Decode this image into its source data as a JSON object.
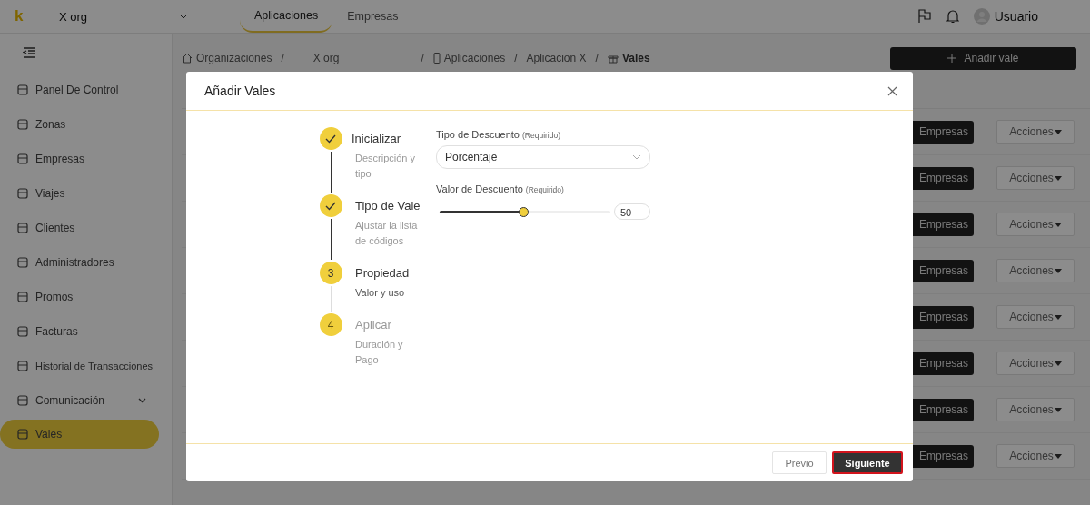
{
  "topbar": {
    "logo": "k",
    "org": "X org",
    "tabs": [
      {
        "label": "Aplicaciones",
        "selected": true
      },
      {
        "label": "Empresas",
        "selected": false
      }
    ],
    "user": "Usuario"
  },
  "sidebar": {
    "items": [
      {
        "label": "Panel De Control",
        "kind": "link",
        "selected": false
      },
      {
        "label": "Zonas",
        "kind": "link",
        "selected": false
      },
      {
        "label": "Empresas",
        "kind": "link",
        "selected": false
      },
      {
        "label": "Viajes",
        "kind": "link",
        "selected": false
      },
      {
        "label": "Clientes",
        "kind": "link",
        "selected": false
      },
      {
        "label": "Administradores",
        "kind": "link",
        "selected": false
      },
      {
        "label": "Promos",
        "kind": "link",
        "selected": false
      },
      {
        "label": "Facturas",
        "kind": "link",
        "selected": false
      },
      {
        "label": "Historial de Transacciones",
        "kind": "link",
        "selected": false
      },
      {
        "label": "Comunicación",
        "kind": "group",
        "selected": false
      },
      {
        "label": "Vales",
        "kind": "link",
        "selected": true
      }
    ]
  },
  "breadcrumb": [
    {
      "label": "Organizaciones",
      "separator": "/"
    },
    {
      "label": "X org",
      "separator": "/"
    },
    {
      "label": "Aplicaciones",
      "separator": "/"
    },
    {
      "label": "Aplicacion X",
      "separator": "/"
    },
    {
      "label": "Vales"
    }
  ],
  "add_button": "Añadir vale",
  "table": {
    "rows": [
      {
        "company": "Empresas",
        "actions": "Acciones"
      },
      {
        "company": "Empresas",
        "actions": "Acciones"
      },
      {
        "company": "Empresas",
        "actions": "Acciones"
      },
      {
        "company": "Empresas",
        "actions": "Acciones"
      },
      {
        "company": "Empresas",
        "actions": "Acciones"
      },
      {
        "company": "Empresas",
        "actions": "Acciones"
      },
      {
        "company": "Empresas",
        "actions": "Acciones"
      },
      {
        "company": "Empresas",
        "actions": "Acciones"
      }
    ]
  },
  "dialog": {
    "title": "Añadir Vales",
    "steps": [
      {
        "kind": "done",
        "title": "Inicializar",
        "subtitle": "Descripción y tipo"
      },
      {
        "kind": "done",
        "title": "Tipo de Vale",
        "subtitle": "Ajustar la lista de códigos"
      },
      {
        "kind": "current",
        "number": "3",
        "title": "Propiedad",
        "subtitle": "Valor y uso"
      },
      {
        "kind": "pending",
        "number": "4",
        "title": "Aplicar",
        "subtitle": "Duración y Pago"
      }
    ],
    "discount_type": {
      "label": "Tipo de Descuento",
      "note": "(Requirido)",
      "value": "Porcentaje"
    },
    "discount_value": {
      "label": "Valor de Descuento",
      "note": "(Requirido)",
      "level": 0.49,
      "value": "50"
    },
    "buttons": [
      {
        "label": "Previo",
        "kind": "secondary"
      },
      {
        "label": "Siguiente",
        "kind": "primary"
      }
    ]
  }
}
